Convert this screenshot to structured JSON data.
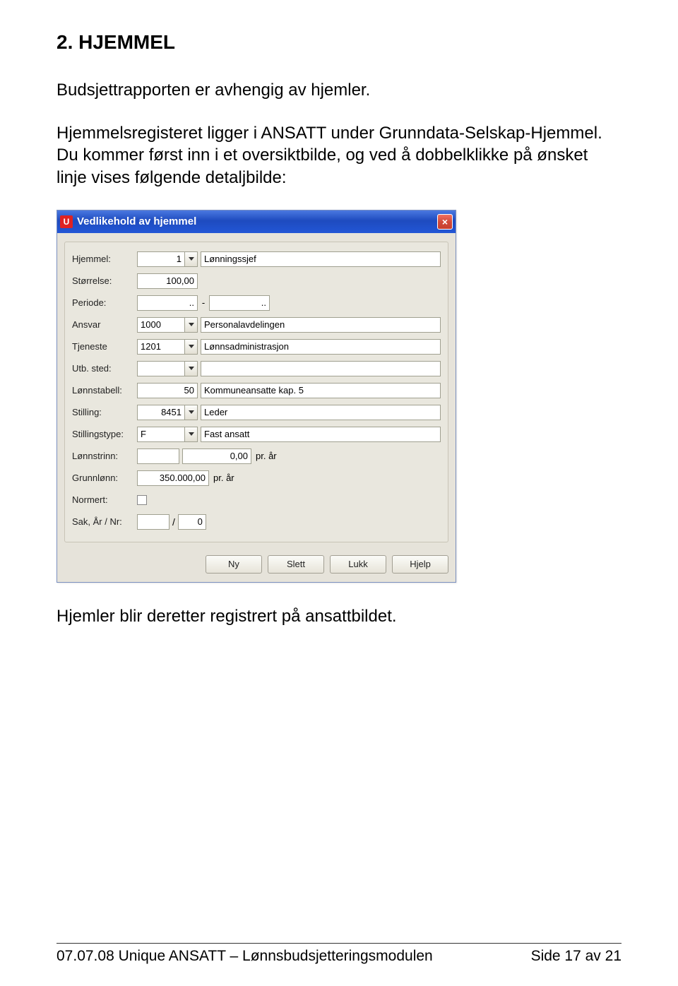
{
  "doc": {
    "heading": "2. HJEMMEL",
    "para1": "Budsjettrapporten er  avhengig av hjemler.",
    "para2": "Hjemmelsregisteret ligger i ANSATT under Grunndata-Selskap-Hjemmel.",
    "para3": "Du kommer først inn i et oversiktbilde, og ved å dobbelklikke på ønsket linje vises følgende detaljbilde:",
    "para_after": "Hjemler blir deretter registrert på ansattbildet."
  },
  "win": {
    "app_icon_letter": "U",
    "title": "Vedlikehold av hjemmel",
    "close": "×"
  },
  "form": {
    "hjemmel": {
      "label": "Hjemmel:",
      "code": "1",
      "desc": "Lønningssjef"
    },
    "storrelse": {
      "label": "Størrelse:",
      "value": "100,00"
    },
    "periode": {
      "label": "Periode:",
      "from": "..",
      "sep": "-",
      "to": ".."
    },
    "ansvar": {
      "label": "Ansvar",
      "code": "1000",
      "desc": "Personalavdelingen"
    },
    "tjeneste": {
      "label": "Tjeneste",
      "code": "1201",
      "desc": "Lønnsadministrasjon"
    },
    "utbsted": {
      "label": "Utb. sted:",
      "code": "",
      "desc": ""
    },
    "lonnstabell": {
      "label": "Lønnstabell:",
      "code": "50",
      "desc": "Kommuneansatte kap. 5"
    },
    "stilling": {
      "label": "Stilling:",
      "code": "8451",
      "desc": "Leder"
    },
    "stillingstype": {
      "label": "Stillingstype:",
      "code": "F",
      "desc": "Fast ansatt"
    },
    "lonnstrinn": {
      "label": "Lønnstrinn:",
      "code": "",
      "amount": "0,00",
      "unit": "pr. år"
    },
    "grunnlonn": {
      "label": "Grunnlønn:",
      "amount": "350.000,00",
      "unit": "pr. år"
    },
    "normert": {
      "label": "Normert:"
    },
    "sak": {
      "label": "Sak, År / Nr:",
      "year": "",
      "slash": "/",
      "nr": "0"
    }
  },
  "buttons": {
    "ny": "Ny",
    "slett": "Slett",
    "lukk": "Lukk",
    "hjelp": "Hjelp"
  },
  "footer": {
    "left": "07.07.08   Unique ANSATT – Lønnsbudsjetteringsmodulen",
    "right": "Side 17 av 21"
  }
}
